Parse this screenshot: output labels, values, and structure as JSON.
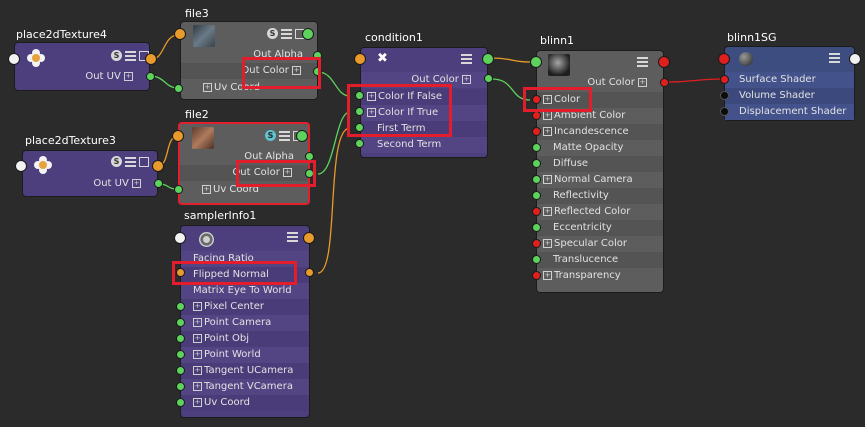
{
  "nodes": {
    "place2dTexture4": {
      "title": "place2dTexture4",
      "out_uv": "Out UV"
    },
    "file3": {
      "title": "file3",
      "out_alpha": "Out Alpha",
      "out_color": "Out Color",
      "uv_coord": "Uv Coord"
    },
    "place2dTexture3": {
      "title": "place2dTexture3",
      "out_uv": "Out UV"
    },
    "file2": {
      "title": "file2",
      "out_alpha": "Out Alpha",
      "out_color": "Out Color",
      "uv_coord": "Uv Coord"
    },
    "samplerInfo1": {
      "title": "samplerInfo1",
      "attributes": [
        "Facing Ratio",
        "Flipped Normal",
        "Matrix Eye To World",
        "Pixel Center",
        "Point Camera",
        "Point Obj",
        "Point World",
        "Tangent UCamera",
        "Tangent VCamera",
        "Uv Coord"
      ]
    },
    "condition1": {
      "title": "condition1",
      "out_color": "Out Color",
      "inputs": [
        "Color If False",
        "Color If True",
        "First Term",
        "Second Term"
      ]
    },
    "blinn1": {
      "title": "blinn1",
      "out_color": "Out Color",
      "attributes": [
        "Color",
        "Ambient Color",
        "Incandescence",
        "Matte Opacity",
        "Diffuse",
        "Normal Camera",
        "Reflectivity",
        "Reflected Color",
        "Eccentricity",
        "Specular Color",
        "Translucence",
        "Transparency"
      ]
    },
    "blinn1SG": {
      "title": "blinn1SG",
      "attributes": [
        "Surface Shader",
        "Volume Shader",
        "Displacement Shader"
      ]
    }
  },
  "icons": {
    "swatch": "S",
    "expand": "+"
  },
  "colors": {
    "background": "#2b2b2b",
    "node_grey": "#5d5d5d",
    "node_purple": "#4d3f7e",
    "node_blue": "#3e4d80",
    "highlight": "#e41d2c",
    "plug_green": "#5dd35d",
    "plug_orange": "#e89a2a",
    "plug_red": "#e01f1f"
  }
}
